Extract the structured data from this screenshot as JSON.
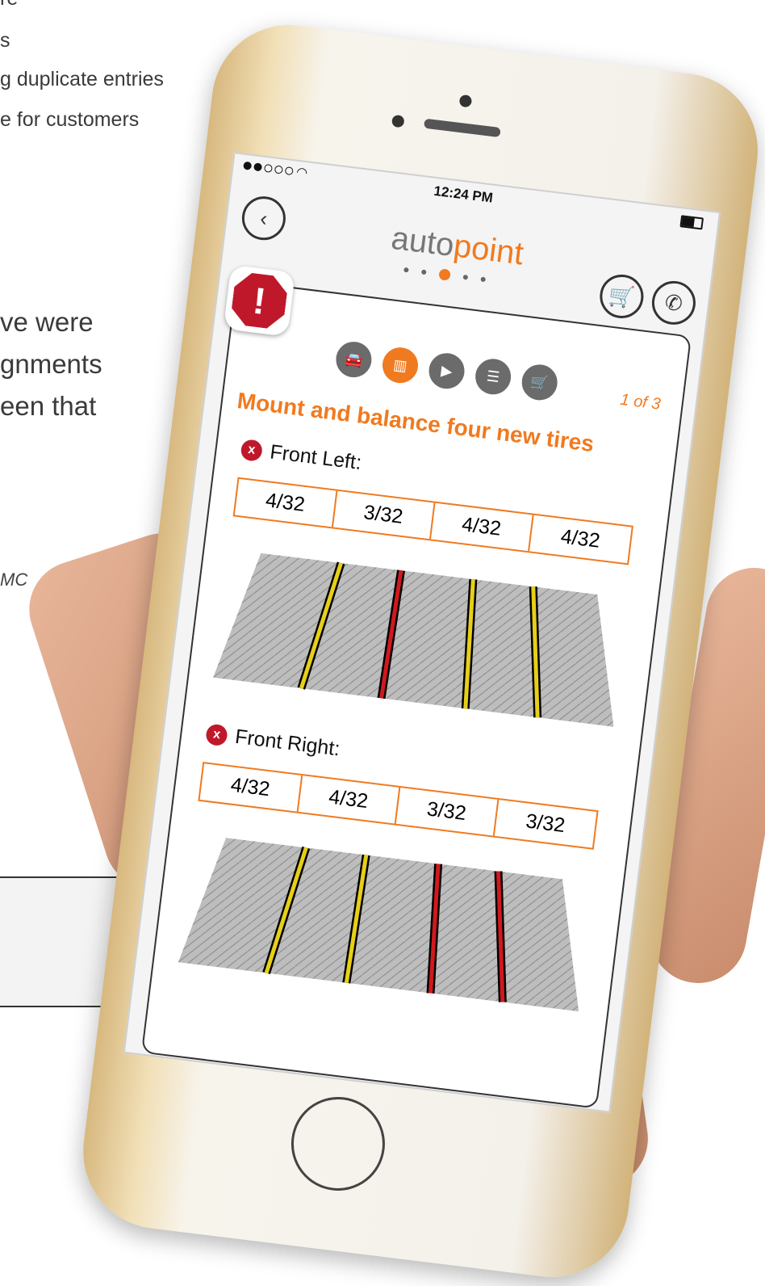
{
  "background": {
    "bullets": [
      "s",
      "g duplicate entries",
      "e for customers"
    ],
    "paragraph": [
      "ve were",
      "gnments",
      "een that"
    ],
    "caption": "MC"
  },
  "statusbar": {
    "time": "12:24 PM"
  },
  "app": {
    "brand": {
      "part1": "auto",
      "part2": "point"
    },
    "page_dots": 5,
    "active_dot": 2,
    "counter": "1 of 3",
    "title": "Mount and balance four new tires",
    "tires": [
      {
        "label": "Front Left:",
        "readings": [
          "4/32",
          "3/32",
          "4/32",
          "4/32"
        ]
      },
      {
        "label": "Front Right:",
        "readings": [
          "4/32",
          "4/32",
          "3/32",
          "3/32"
        ]
      }
    ],
    "categories": [
      "car-icon",
      "tread-gauge-icon",
      "play-icon",
      "document-icon",
      "cart-icon"
    ],
    "active_category": 1
  },
  "colors": {
    "accent": "#f07a20",
    "alert": "#c0182b",
    "yellow_groove": "#e6cf18",
    "red_groove": "#d0191e"
  }
}
